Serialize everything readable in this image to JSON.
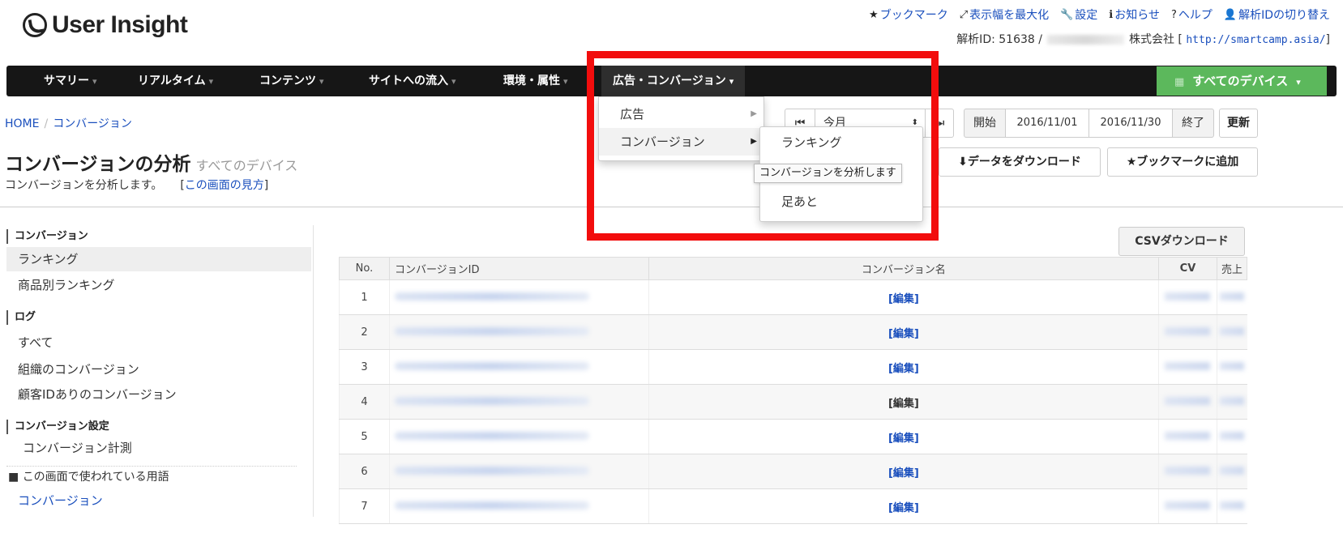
{
  "brand": {
    "logo_text": "User Insight"
  },
  "toplinks": [
    {
      "icon": "star-icon",
      "glyph": "★",
      "label": "ブックマーク"
    },
    {
      "icon": "expand-icon",
      "glyph": "⤢",
      "label": "表示幅を最大化"
    },
    {
      "icon": "wrench-icon",
      "glyph": "🔧",
      "label": "設定"
    },
    {
      "icon": "info-icon",
      "glyph": "ℹ",
      "label": "お知らせ"
    },
    {
      "icon": "help-icon",
      "glyph": "?",
      "label": "ヘルプ"
    },
    {
      "icon": "user-icon",
      "glyph": "👤",
      "label": "解析IDの切り替え"
    }
  ],
  "account": {
    "id_label": "解析ID: 51638 /",
    "company_suffix": "株式会社 [",
    "url": "http://smartcamp.asia/",
    "close": "]"
  },
  "nav": {
    "items": [
      "サマリー",
      "リアルタイム",
      "コンテンツ",
      "サイトへの流入",
      "環境・属性",
      "広告・コンバージョン"
    ],
    "caret": "▾",
    "device_button": "すべてのデバイス"
  },
  "breadcrumb": {
    "home": "HOME",
    "separator": "/",
    "current": "コンバージョン"
  },
  "page": {
    "title": "コンバージョンの分析",
    "subtitle": "すべてのデバイス",
    "description": "コンバージョンを分析します。",
    "help_open": "[",
    "help_link": "この画面の見方",
    "help_close": "]"
  },
  "period": {
    "first_icon": "⏮",
    "select_value": "今月",
    "last_icon": "⏭",
    "start_label": "開始",
    "start_date": "2016/11/01",
    "end_date": "2016/11/30",
    "end_label": "終了",
    "update_button": "更新"
  },
  "actions": {
    "download": "データをダウンロード",
    "bookmark": "★ブックマークに追加",
    "csv": "CSVダウンロード"
  },
  "sidebar": {
    "sections": [
      {
        "heading": "コンバージョン",
        "items": [
          "ランキング",
          "商品別ランキング"
        ]
      },
      {
        "heading": "ログ",
        "items": [
          "すべて",
          "組織のコンバージョン",
          "顧客IDありのコンバージョン"
        ]
      },
      {
        "heading": "コンバージョン設定",
        "items": [
          "コンバージョン計測"
        ]
      }
    ],
    "glossary_heading": "この画面で使われている用語",
    "glossary_item": "コンバージョン",
    "selected": "ランキング"
  },
  "table": {
    "headers": [
      "No.",
      "コンバージョンID",
      "コンバージョン名",
      "CV",
      "売上"
    ],
    "rows": [
      {
        "no": "1",
        "edit": "[編集]"
      },
      {
        "no": "2",
        "edit": "[編集]"
      },
      {
        "no": "3",
        "edit": "[編集]"
      },
      {
        "no": "4",
        "edit": "[編集]"
      },
      {
        "no": "5",
        "edit": "[編集]"
      },
      {
        "no": "6",
        "edit": "[編集]"
      },
      {
        "no": "7",
        "edit": "[編集]"
      }
    ]
  },
  "dropdown": {
    "items": [
      "広告",
      "コンバージョン"
    ],
    "submenu": [
      "ランキング",
      "足あと"
    ],
    "tooltip": "コンバージョンを分析します"
  },
  "colors": {
    "accent_red": "#f20d0d",
    "nav_bg": "#161616",
    "device_green": "#5cb85c",
    "link_blue": "#1a4fbd"
  }
}
